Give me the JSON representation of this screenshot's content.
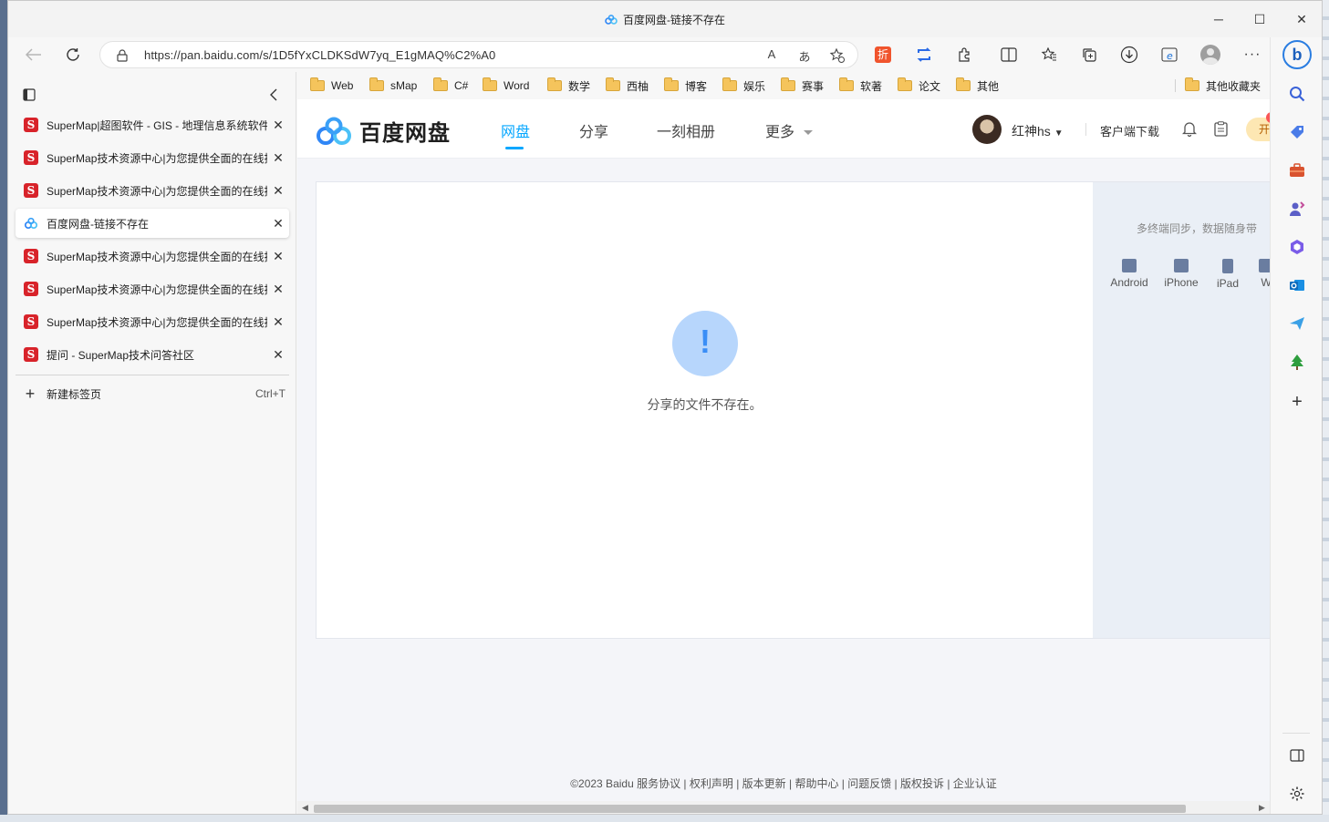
{
  "window": {
    "title": "百度网盘-链接不存在",
    "controls": {
      "minimize": "─",
      "maximize": "☐",
      "close": "✕"
    }
  },
  "address_bar": {
    "url": "https://pan.baidu.com/s/1D5fYxCLDKSdW7yq_E1gMAQ%C2%A0",
    "read_aloud": "A",
    "translate": "あ"
  },
  "bookmarks": [
    "Web",
    "sMap",
    "C#",
    "Word",
    "数学",
    "西柚",
    "博客",
    "娱乐",
    "赛事",
    "软著",
    "论文",
    "其他"
  ],
  "bookmarks_other": "其他收藏夹",
  "tabs": [
    {
      "title": "SuperMap|超图软件 - GIS - 地理信息系统软件",
      "favicon": "supermap-icon",
      "active": false
    },
    {
      "title": "SuperMap技术资源中心|为您提供全面的在线技术服务",
      "favicon": "supermap-icon",
      "active": false
    },
    {
      "title": "SuperMap技术资源中心|为您提供全面的在线技术服务",
      "favicon": "supermap-icon",
      "active": false
    },
    {
      "title": "百度网盘-链接不存在",
      "favicon": "baidu-pan-icon",
      "active": true
    },
    {
      "title": "SuperMap技术资源中心|为您提供全面的在线技术服务",
      "favicon": "supermap-icon",
      "active": false
    },
    {
      "title": "SuperMap技术资源中心|为您提供全面的在线技术服务",
      "favicon": "supermap-icon",
      "active": false
    },
    {
      "title": "SuperMap技术资源中心|为您提供全面的在线技术服务",
      "favicon": "supermap-icon",
      "active": false
    },
    {
      "title": "提问 - SuperMap技术问答社区",
      "favicon": "supermap-icon",
      "active": false
    }
  ],
  "tab_favicon_letter": "S",
  "new_tab": {
    "label": "新建标签页",
    "shortcut": "Ctrl+T"
  },
  "baidu": {
    "logo_text": "百度网盘",
    "nav": [
      "网盘",
      "分享",
      "一刻相册",
      "更多"
    ],
    "user_name": "红神hs",
    "client_download": "客户端下载",
    "vip_label": "开",
    "error_symbol": "!",
    "error_message": "分享的文件不存在。",
    "side_text": "多终端同步，数据随身带",
    "devices": [
      "Android",
      "iPhone",
      "iPad",
      "W"
    ],
    "footer": "©2023 Baidu  服务协议 | 权利声明 | 版本更新 | 帮助中心 | 问题反馈 | 版权投诉 | 企业认证"
  },
  "colors": {
    "accent": "#06a7ff",
    "supermap_red": "#d8232a",
    "error_circle": "#b7d6fc"
  }
}
